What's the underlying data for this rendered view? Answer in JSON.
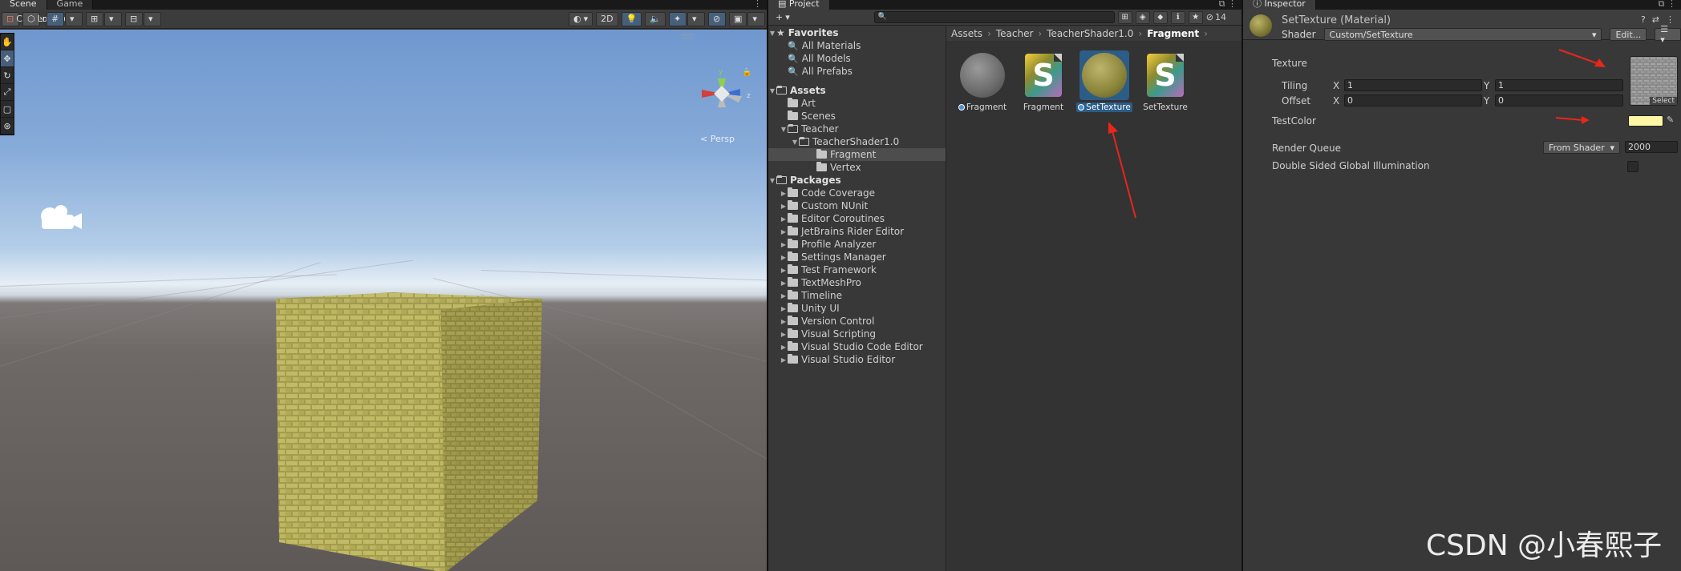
{
  "scene": {
    "tabs": [
      "Scene",
      "Game"
    ],
    "pivot_label": "Center",
    "space_label": "Local",
    "btn_2d": "2D",
    "persp_label": "< Persp",
    "gizmo_axes": {
      "y": "y",
      "z": "z"
    }
  },
  "project": {
    "tab_label": "Project",
    "add_label": "+",
    "hidden_count": "14",
    "tree": {
      "favorites_label": "Favorites",
      "favorites": [
        "All Materials",
        "All Models",
        "All Prefabs"
      ],
      "assets_label": "Assets",
      "assets": [
        "Art",
        "Scenes",
        "Teacher",
        "TeacherShader1.0",
        "Fragment",
        "Vertex"
      ],
      "packages_label": "Packages",
      "packages": [
        "Code Coverage",
        "Custom NUnit",
        "Editor Coroutines",
        "JetBrains Rider Editor",
        "Profile Analyzer",
        "Settings Manager",
        "Test Framework",
        "TextMeshPro",
        "Timeline",
        "Unity UI",
        "Version Control",
        "Visual Scripting",
        "Visual Studio Code Editor",
        "Visual Studio Editor"
      ]
    },
    "breadcrumb": [
      "Assets",
      "Teacher",
      "TeacherShader1.0",
      "Fragment"
    ],
    "items": [
      {
        "label": "Fragment",
        "kind": "material"
      },
      {
        "label": "Fragment",
        "kind": "shader"
      },
      {
        "label": "SetTexture",
        "kind": "material"
      },
      {
        "label": "SetTexture",
        "kind": "shader"
      }
    ]
  },
  "inspector": {
    "tab_label": "Inspector",
    "title": "SetTexture (Material)",
    "shader_label": "Shader",
    "shader_value": "Custom/SetTexture",
    "edit_label": "Edit...",
    "texture_label": "Texture",
    "tiling_label": "Tiling",
    "offset_label": "Offset",
    "x_label": "X",
    "y_label": "Y",
    "tiling_x": "1",
    "tiling_y": "1",
    "offset_x": "0",
    "offset_y": "0",
    "select_label": "Select",
    "testcolor_label": "TestColor",
    "testcolor_value": "#FDF6A4",
    "render_queue_label": "Render Queue",
    "render_queue_mode": "From Shader",
    "render_queue_value": "2000",
    "dsgi_label": "Double Sided Global Illumination"
  },
  "watermark": "CSDN @小春熙子"
}
